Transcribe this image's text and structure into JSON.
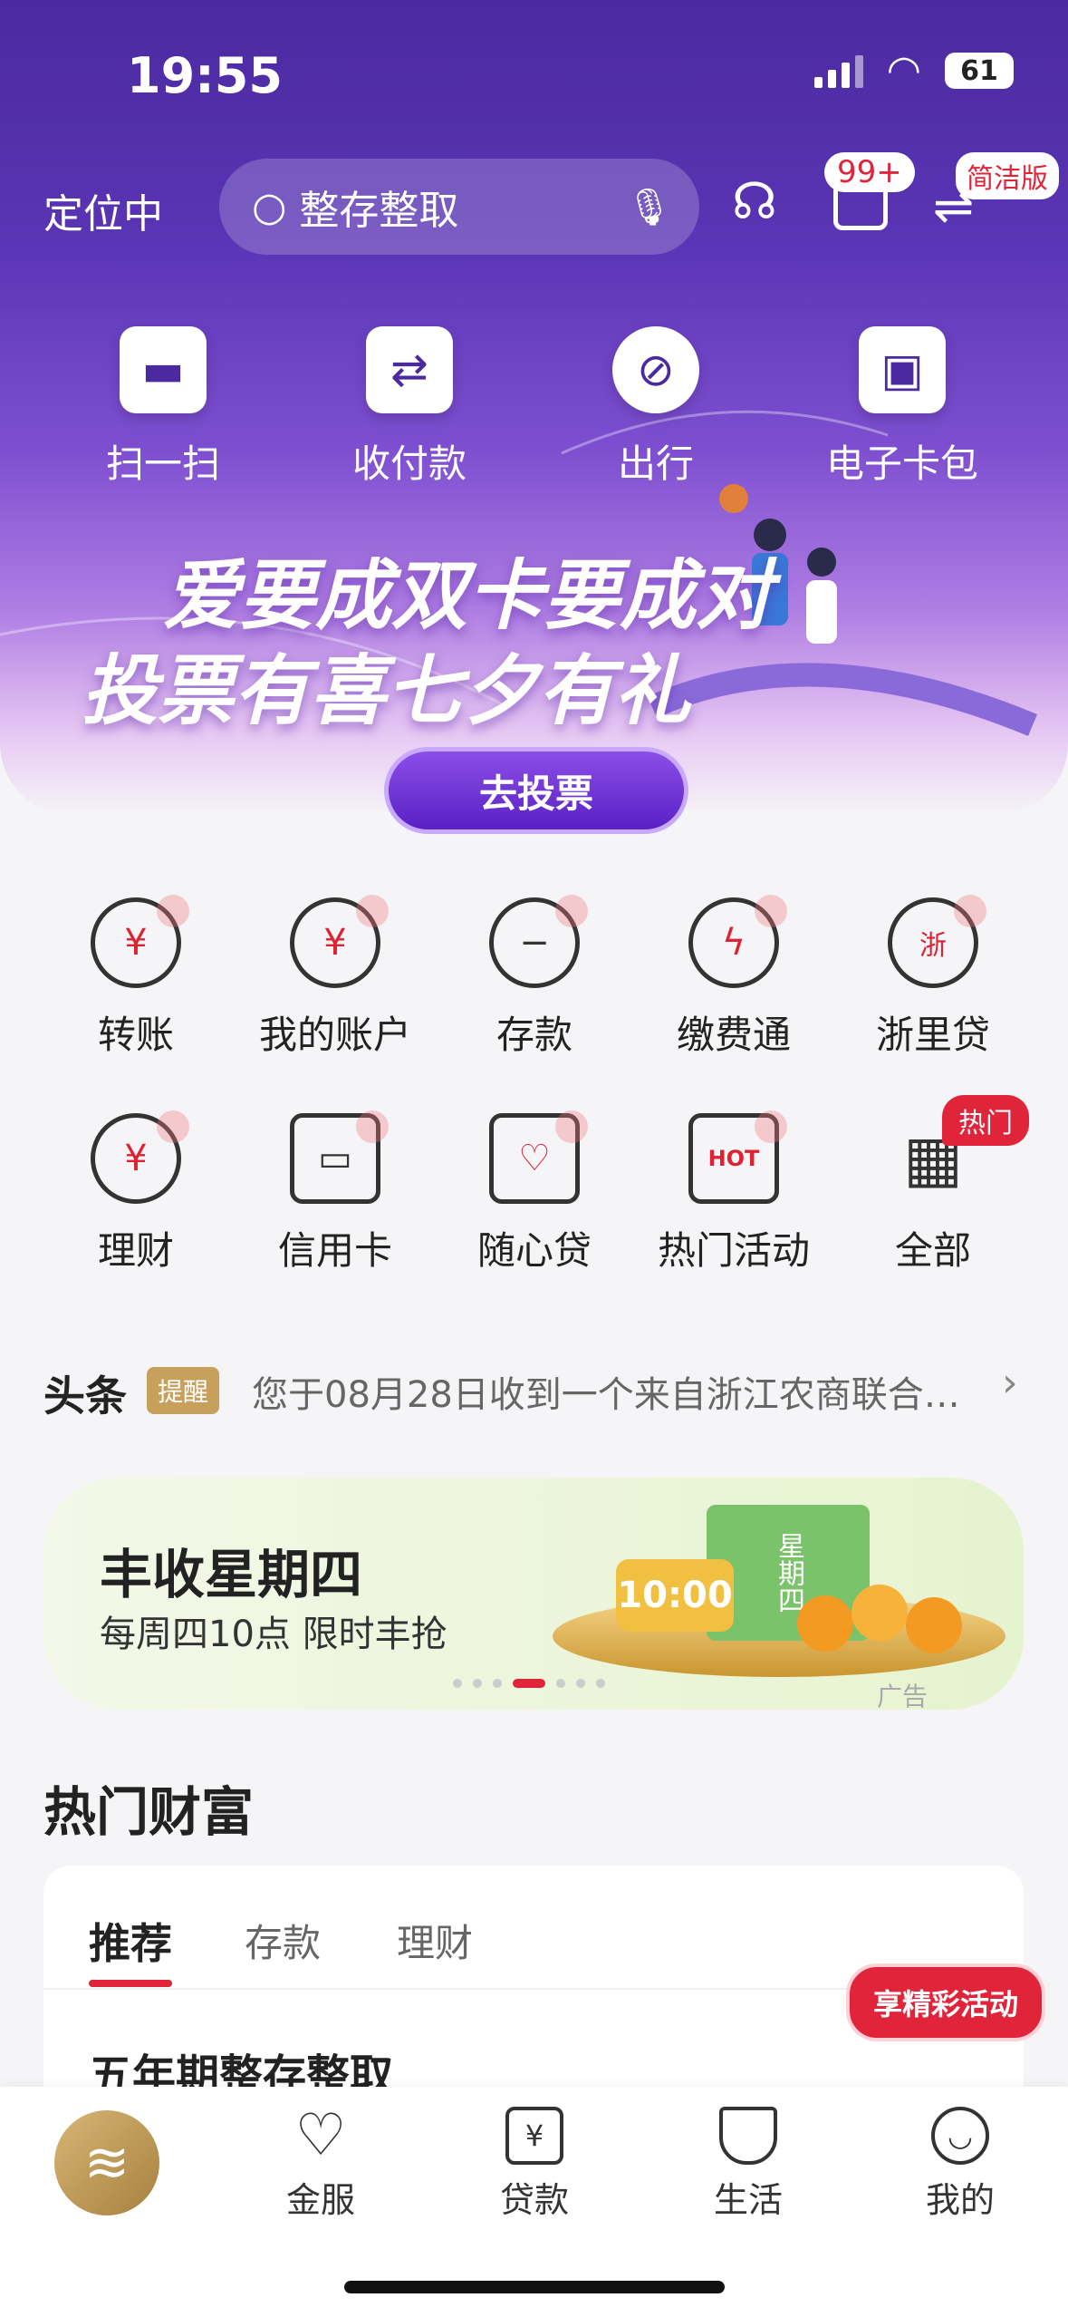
{
  "status_bar": {
    "time": "19:55",
    "battery": "61"
  },
  "header": {
    "location": "定位中",
    "search_text": "整存整取",
    "message_badge": "99+",
    "simple_mode": "简洁版"
  },
  "quick_actions": [
    {
      "label": "扫一扫",
      "icon": "scan-icon"
    },
    {
      "label": "收付款",
      "icon": "transfer-arrows-icon"
    },
    {
      "label": "出行",
      "icon": "compass-icon"
    },
    {
      "label": "电子卡包",
      "icon": "wallet-icon"
    }
  ],
  "banner": {
    "line1": "爱要成双卡要成对",
    "line2": "投票有喜七夕有礼",
    "button": "去投票"
  },
  "services": [
    {
      "label": "转账",
      "glyph": "¥",
      "icon": "transfer-icon"
    },
    {
      "label": "我的账户",
      "glyph": "¥",
      "icon": "account-bag-icon"
    },
    {
      "label": "存款",
      "glyph": "−",
      "icon": "piggy-bank-icon"
    },
    {
      "label": "缴费通",
      "glyph": "ϟ",
      "icon": "bill-payment-icon"
    },
    {
      "label": "浙里贷",
      "glyph": "浙",
      "icon": "loan-bag-icon"
    },
    {
      "label": "理财",
      "glyph": "¥",
      "icon": "wealth-icon"
    },
    {
      "label": "信用卡",
      "glyph": "▭",
      "icon": "credit-card-icon"
    },
    {
      "label": "随心贷",
      "glyph": "♡",
      "icon": "heart-bag-icon"
    },
    {
      "label": "热门活动",
      "glyph": "HOT",
      "icon": "hot-gift-icon"
    },
    {
      "label": "全部",
      "glyph": "▦",
      "icon": "all-apps-icon"
    }
  ],
  "hot_badge": "热门",
  "news": {
    "title": "头条",
    "tag": "提醒",
    "text": "您于08月28日收到一个来自浙江农商联合…"
  },
  "promo": {
    "title": "丰收星期四",
    "subtitle": "每周四10点 限时丰抢",
    "clock": "10:00",
    "box_text": "星期四",
    "ad_label": "广告"
  },
  "wealth": {
    "title": "热门财富",
    "tabs": [
      "推荐",
      "存款",
      "理财"
    ],
    "event_button": "享精彩活动",
    "product": "五年期整存整取"
  },
  "bottom_nav": [
    {
      "label": "金服",
      "icon": "heart-icon"
    },
    {
      "label": "贷款",
      "icon": "loan-icon"
    },
    {
      "label": "生活",
      "icon": "cup-icon"
    },
    {
      "label": "我的",
      "icon": "smile-icon"
    }
  ],
  "colors": {
    "brand_red": "#e0243a",
    "hero_purple": "#4b2aa0",
    "gold": "#c7a05c"
  }
}
